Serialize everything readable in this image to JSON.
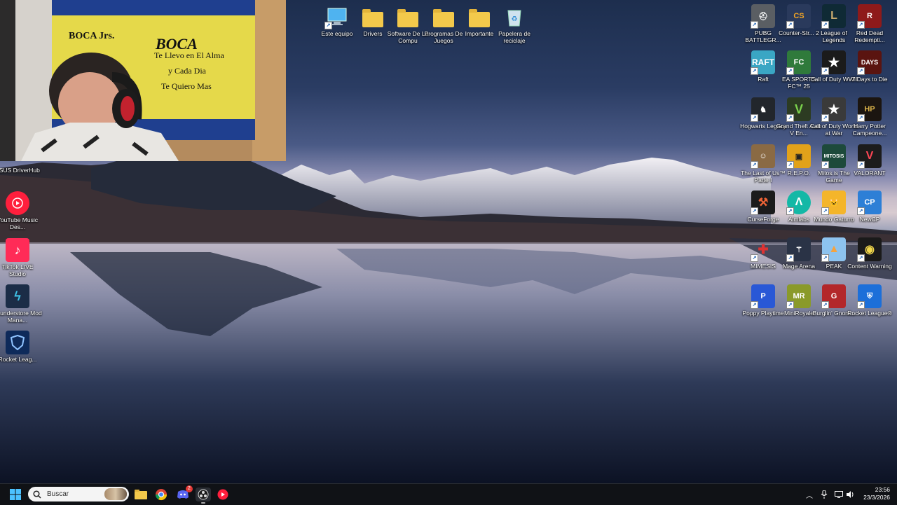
{
  "webcam": {
    "banner_line1": "BOCA Jrs.",
    "banner_line2": "BOCA",
    "banner_line3": "Te Llevo en El Alma",
    "banner_line4": "y Cada Dia",
    "banner_line5": "Te Quiero Mas"
  },
  "top_icons": [
    {
      "label": "Este equipo",
      "icon": "computer-icon"
    },
    {
      "label": "Drivers",
      "icon": "folder-icon"
    },
    {
      "label": "Software De La Compu",
      "icon": "folder-icon"
    },
    {
      "label": "Programas De Juegos",
      "icon": "folder-icon"
    },
    {
      "label": "Importante",
      "icon": "folder-icon"
    },
    {
      "label": "Papelera de reciclaje",
      "icon": "recycle-bin-icon"
    }
  ],
  "left_icons": [
    {
      "label": "ASUS DriverHub",
      "icon": "asus-icon"
    },
    {
      "label": "YouTube Music Des...",
      "icon": "youtube-music-icon"
    },
    {
      "label": "TikTok LIVE Studio",
      "icon": "tiktok-icon"
    },
    {
      "label": "Thunderstore Mod Mana...",
      "icon": "thunderstore-icon"
    },
    {
      "label": "Rocket Leag...",
      "icon": "rocket-league-shield-icon"
    }
  ],
  "right_icons": [
    {
      "label": "PUBG BATTLEGR...",
      "icon": "pubg-icon"
    },
    {
      "label": "Counter-Str... 2",
      "icon": "counter-strike-icon"
    },
    {
      "label": "League of Legends",
      "icon": "league-of-legends-icon"
    },
    {
      "label": "Red Dead Redempti...",
      "icon": "red-dead-icon"
    },
    {
      "label": "Raft",
      "icon": "raft-icon"
    },
    {
      "label": "EA SPORTS FC™ 25",
      "icon": "ea-fc-icon"
    },
    {
      "label": "Call of Duty WWII",
      "icon": "cod-wwii-icon"
    },
    {
      "label": "7 Days to Die",
      "icon": "seven-days-icon"
    },
    {
      "label": "Hogwarts Legacy",
      "icon": "hogwarts-icon"
    },
    {
      "label": "Grand Theft Auto V En...",
      "icon": "gta-v-icon"
    },
    {
      "label": "Call of Duty World at War",
      "icon": "cod-waw-icon"
    },
    {
      "label": "Harry Potter Campeone...",
      "icon": "harry-potter-icon"
    },
    {
      "label": "The Last of Us™ Parte I",
      "icon": "last-of-us-icon"
    },
    {
      "label": "R.E.P.O.",
      "icon": "repo-icon"
    },
    {
      "label": "Mitos.is The Game",
      "icon": "mitosis-icon"
    },
    {
      "label": "VALORANT",
      "icon": "valorant-icon"
    },
    {
      "label": "CurseForge",
      "icon": "curseforge-icon"
    },
    {
      "label": "Aimlabs",
      "icon": "aimlabs-icon"
    },
    {
      "label": "Mundo Gaturro",
      "icon": "gaturro-icon"
    },
    {
      "label": "NewCP",
      "icon": "newcp-icon"
    },
    {
      "label": "MIMESIS",
      "icon": "mimesis-icon"
    },
    {
      "label": "Mage Arena",
      "icon": "mage-arena-icon"
    },
    {
      "label": "PEAK",
      "icon": "peak-icon"
    },
    {
      "label": "Content Warning",
      "icon": "content-warning-icon"
    },
    {
      "label": "Poppy Playtime",
      "icon": "poppy-icon"
    },
    {
      "label": "MiniRoyale",
      "icon": "miniroyale-icon"
    },
    {
      "label": "Burglin' Gnom...",
      "icon": "burglin-icon"
    },
    {
      "label": "Rocket League®",
      "icon": "rocket-league-icon"
    }
  ],
  "taskbar": {
    "search_placeholder": "Buscar",
    "discord_badge": "2",
    "time": "23:56",
    "date": "23/3/2026"
  },
  "colors": {
    "taskbar_bg": "#101216",
    "folder": "#f3c94b"
  }
}
